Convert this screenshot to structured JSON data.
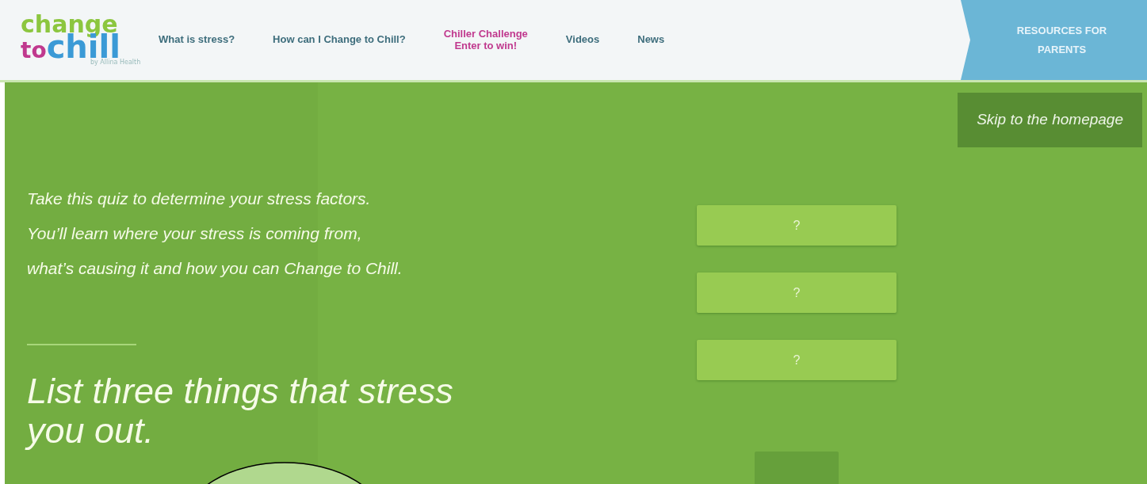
{
  "logo": {
    "line_1": "change",
    "line_2a": "to",
    "line_2b": "chill",
    "tagline": "by Allina Health"
  },
  "nav": [
    {
      "label": "What is stress?",
      "kind": "plain"
    },
    {
      "label": "How can I Change to Chill?",
      "kind": "plain"
    },
    {
      "label": "Chiller Challenge",
      "label_2": "Enter to win!",
      "kind": "promo"
    },
    {
      "label": "Videos",
      "kind": "plain"
    },
    {
      "label": "News",
      "kind": "plain"
    }
  ],
  "resources_button": {
    "label": "RESOURCES FOR PARENTS"
  },
  "skip_button": {
    "label": "Skip to the homepage"
  },
  "intro": "Take this quiz to determine your stress factors. You’ll learn where your stress is coming from, what’s causing it and how you can Change to Chill.",
  "question": "List three things that stress you out.",
  "answers": [
    {
      "placeholder": "?"
    },
    {
      "placeholder": "?"
    },
    {
      "placeholder": "?"
    }
  ],
  "submit_button": {
    "disabled": true
  }
}
